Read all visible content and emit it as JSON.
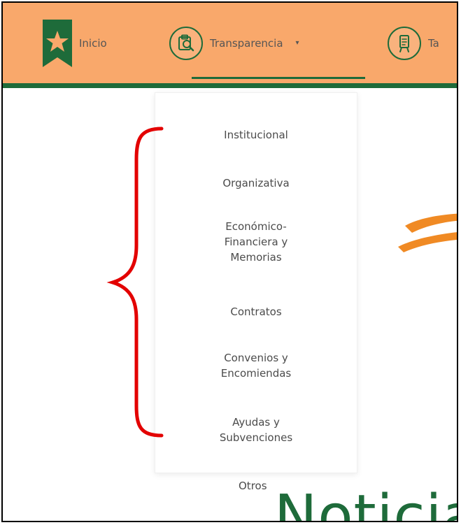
{
  "colors": {
    "navbar_bg": "#F9A86B",
    "accent_green": "#1e6b3a",
    "brace_red": "#e30000",
    "orange_mark": "#F08A24"
  },
  "nav": {
    "items": [
      {
        "label": "Inicio",
        "icon": "star-badge-icon"
      },
      {
        "label": "Transparencia",
        "icon": "clipboard-search-icon",
        "has_dropdown": true,
        "active": true
      },
      {
        "label": "Ta",
        "icon": "document-stand-icon"
      }
    ],
    "caret_symbol": "▾"
  },
  "dropdown": {
    "items": [
      {
        "label": "Institucional"
      },
      {
        "label": "Organizativa"
      },
      {
        "label": "Económico-\nFinanciera y\nMemorias"
      },
      {
        "label": "Contratos"
      },
      {
        "label": "Convenios y\nEncomiendas"
      },
      {
        "label": "Ayudas y\nSubvenciones"
      }
    ],
    "overflow_item": "Otros"
  },
  "main": {
    "heading_partial": "Noticia"
  }
}
